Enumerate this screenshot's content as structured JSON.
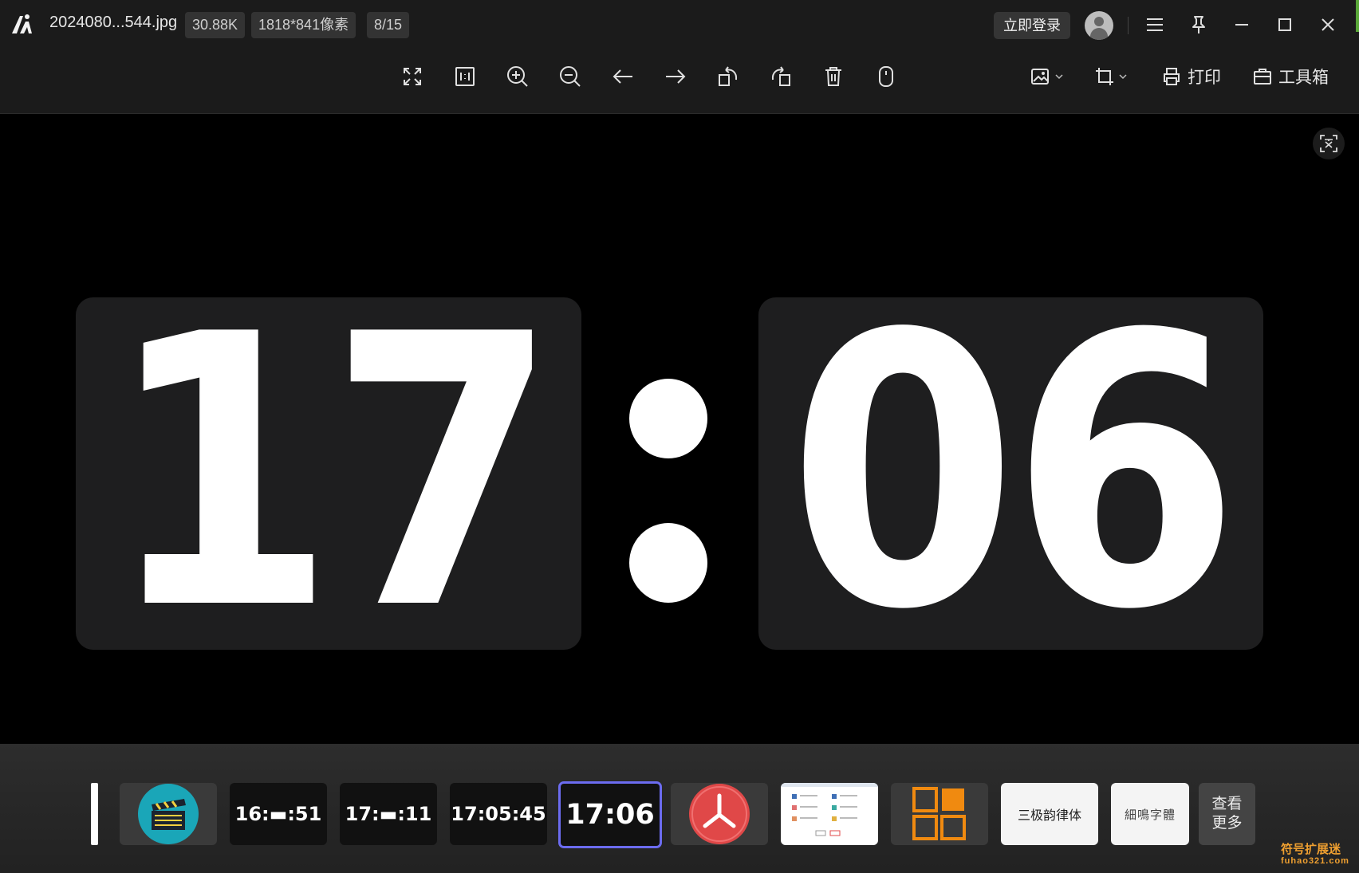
{
  "titlebar": {
    "filename": "2024080...544.jpg",
    "file_size": "30.88K",
    "dimensions": "1818*841像素",
    "position": "8/15",
    "login_label": "立即登录"
  },
  "toolbar": {
    "tools": [
      "fullscreen-icon",
      "actual-size-icon",
      "zoom-in-icon",
      "zoom-out-icon",
      "previous-icon",
      "next-icon",
      "rotate-left-icon",
      "rotate-right-icon",
      "delete-icon",
      "mouse-icon"
    ],
    "print_label": "打印",
    "toolbox_label": "工具箱"
  },
  "viewer": {
    "hours": "17",
    "minutes": "06"
  },
  "thumbnails": {
    "items": [
      {
        "type": "clapper-icon"
      },
      {
        "text": "16:▬:51"
      },
      {
        "text": "17:▬:11"
      },
      {
        "text": "17:05:45"
      },
      {
        "text": "17:06",
        "selected": true
      },
      {
        "type": "red-app-icon"
      },
      {
        "type": "screenshot"
      },
      {
        "type": "orange-grid-icon"
      },
      {
        "text": "三极韵律体"
      },
      {
        "text": "細鳴字體"
      }
    ],
    "more_label_line1": "查看",
    "more_label_line2": "更多"
  },
  "watermark": {
    "line1": "符号扩展迷",
    "line2": "fuhao321.com"
  },
  "colors": {
    "selected_border": "#6c6cf0",
    "clapper_bg": "#1aa6b8",
    "red_app": "#e04848",
    "orange": "#f08a10"
  }
}
